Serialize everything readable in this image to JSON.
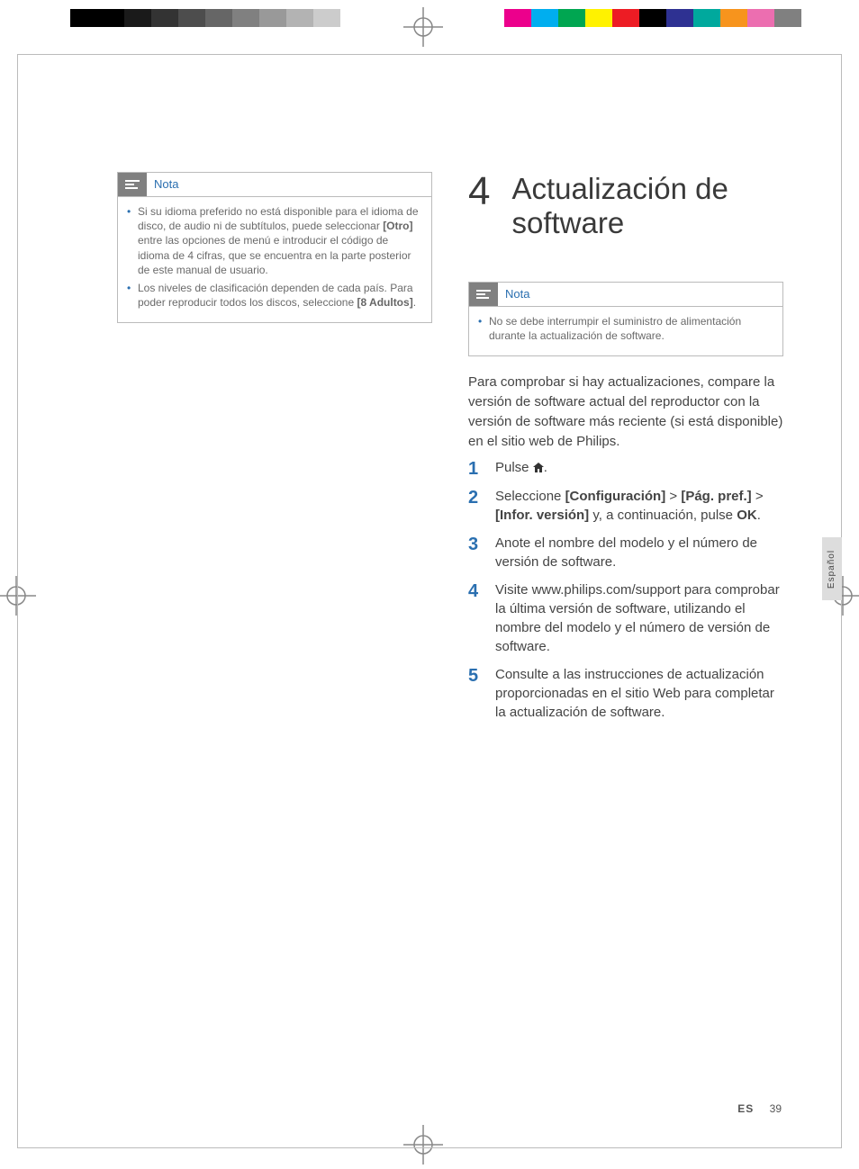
{
  "left_note": {
    "title": "Nota",
    "items": [
      {
        "pre": "Si su idioma preferido no está disponible para el idioma de disco, de audio ni de subtítulos, puede seleccionar ",
        "b1": "[Otro]",
        "post": " entre las opciones de menú e introducir el código de idioma de 4 cifras, que se encuentra en la parte posterior de este manual de usuario."
      },
      {
        "pre": "Los niveles de clasificación dependen de cada país. Para poder reproducir todos los discos, seleccione ",
        "b1": "[8 Adultos]",
        "post": "."
      }
    ]
  },
  "chapter": {
    "num": "4",
    "title": "Actualización de software"
  },
  "right_note": {
    "title": "Nota",
    "items": [
      "No se debe interrumpir el suministro de alimentación durante la actualización de software."
    ]
  },
  "intro": "Para comprobar si hay actualizaciones, compare la versión de software actual del reproductor con la versión de software más reciente (si está disponible) en el sitio web de Philips.",
  "steps": {
    "s1_pre": "Pulse ",
    "s1_post": ".",
    "s2_a": "Seleccione ",
    "s2_b1": "[Configuración]",
    "s2_sep1": " > ",
    "s2_b2": "[Pág. pref.]",
    "s2_sep2": " > ",
    "s2_b3": "[Infor. versión]",
    "s2_c": " y, a continuación, pulse ",
    "s2_ok": "OK",
    "s2_d": ".",
    "s3": "Anote el nombre del modelo y el número de versión de software.",
    "s4": "Visite www.philips.com/support para comprobar la última versión de software, utilizando el nombre del modelo y el número de versión de software.",
    "s5": "Consulte a las instrucciones de actualización proporcionadas en el sitio Web para completar la actualización de software."
  },
  "lang_tab": "Español",
  "footer": {
    "lang": "ES",
    "page": "39"
  },
  "reg_colors_left": [
    "#000000",
    "#000000",
    "#1a1a1a",
    "#333333",
    "#4d4d4d",
    "#666666",
    "#808080",
    "#999999",
    "#b3b3b3",
    "#cccccc",
    "#ffffff"
  ],
  "reg_colors_right": [
    "#ec008c",
    "#00aeef",
    "#00a651",
    "#fff200",
    "#ed1c24",
    "#000000",
    "#2e3192",
    "#00a99d",
    "#f7941d",
    "#ec6eb0",
    "#808080"
  ]
}
